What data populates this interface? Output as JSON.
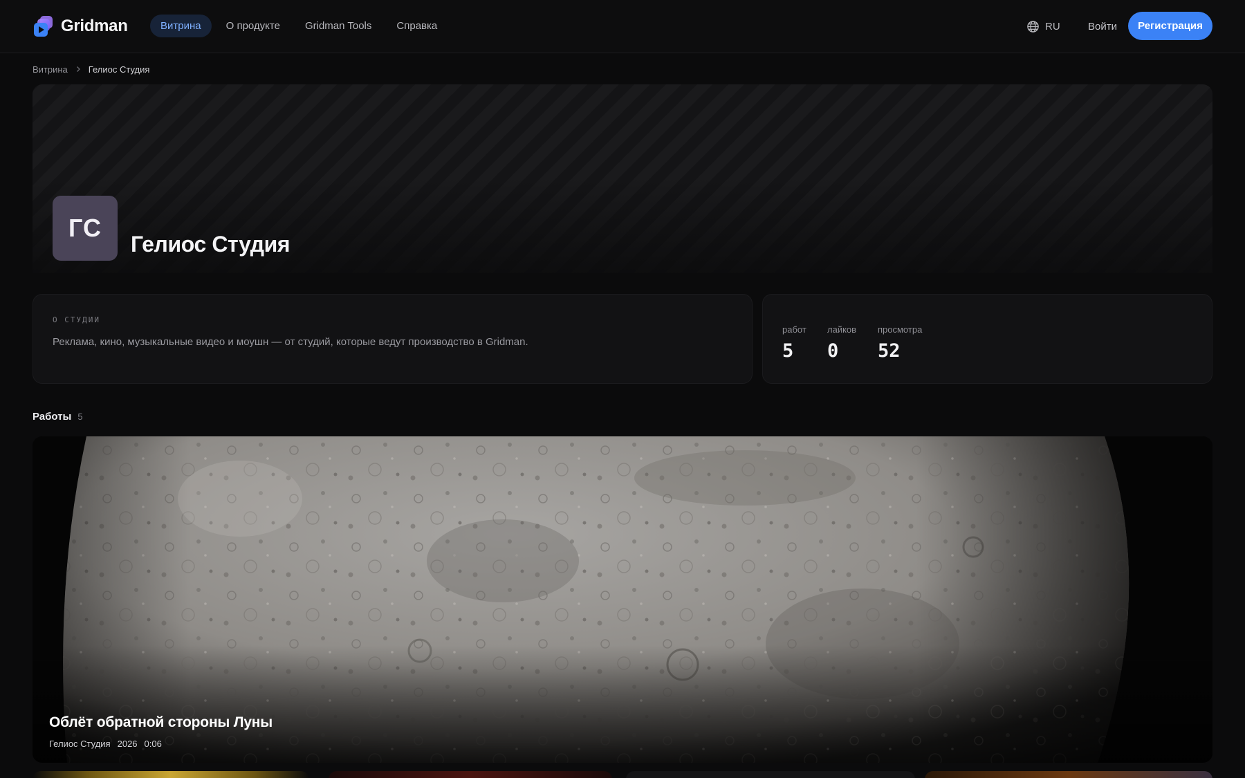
{
  "header": {
    "logo_text": "Gridman",
    "nav": [
      {
        "label": "Витрина",
        "active": true
      },
      {
        "label": "О продукте",
        "active": false
      },
      {
        "label": "Gridman Tools",
        "active": false
      },
      {
        "label": "Справка",
        "active": false
      }
    ],
    "language": "RU",
    "login_label": "Войти",
    "signup_label": "Регистрация"
  },
  "breadcrumb": {
    "root": "Витрина",
    "current": "Гелиос Студия"
  },
  "studio": {
    "initials": "ГС",
    "name": "Гелиос Студия"
  },
  "about": {
    "label": "О СТУДИИ",
    "text": "Реклама, кино, музыкальные видео и моушн — от студий, которые ведут производство в Gridman."
  },
  "stats": [
    {
      "label": "работ",
      "value": "5"
    },
    {
      "label": "лайков",
      "value": "0"
    },
    {
      "label": "просмотра",
      "value": "52"
    }
  ],
  "works": {
    "title": "Работы",
    "count": "5",
    "featured": {
      "title": "Облёт обратной стороны Луны",
      "studio": "Гелиос Студия",
      "year": "2026",
      "duration": "0:06"
    }
  },
  "colors": {
    "accent": "#3b82f6",
    "nav_active_bg": "#172338",
    "nav_active_text": "#7fb0ff",
    "avatar_bg": "#4a4458"
  }
}
